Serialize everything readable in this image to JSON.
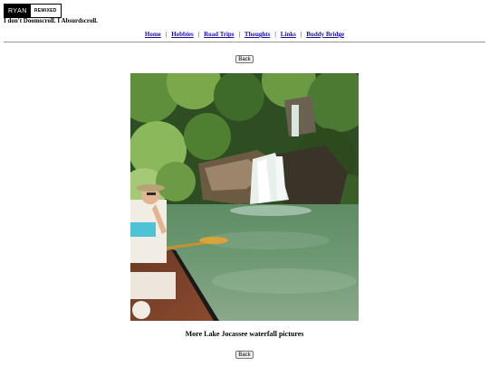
{
  "header": {
    "logo_name": "RYAN",
    "logo_suffix": "REMIXED",
    "tagline": "I don't Doomscroll. I Absurdscroll."
  },
  "nav": {
    "items": [
      "Home",
      "Hobbies",
      "Road Trips",
      "Thoughts",
      "Links",
      "Buddy Bridge"
    ],
    "separator": "|"
  },
  "buttons": {
    "back_top": "Back",
    "back_bottom": "Back"
  },
  "photo": {
    "caption": "More Lake Jocassee waterfall pictures"
  }
}
